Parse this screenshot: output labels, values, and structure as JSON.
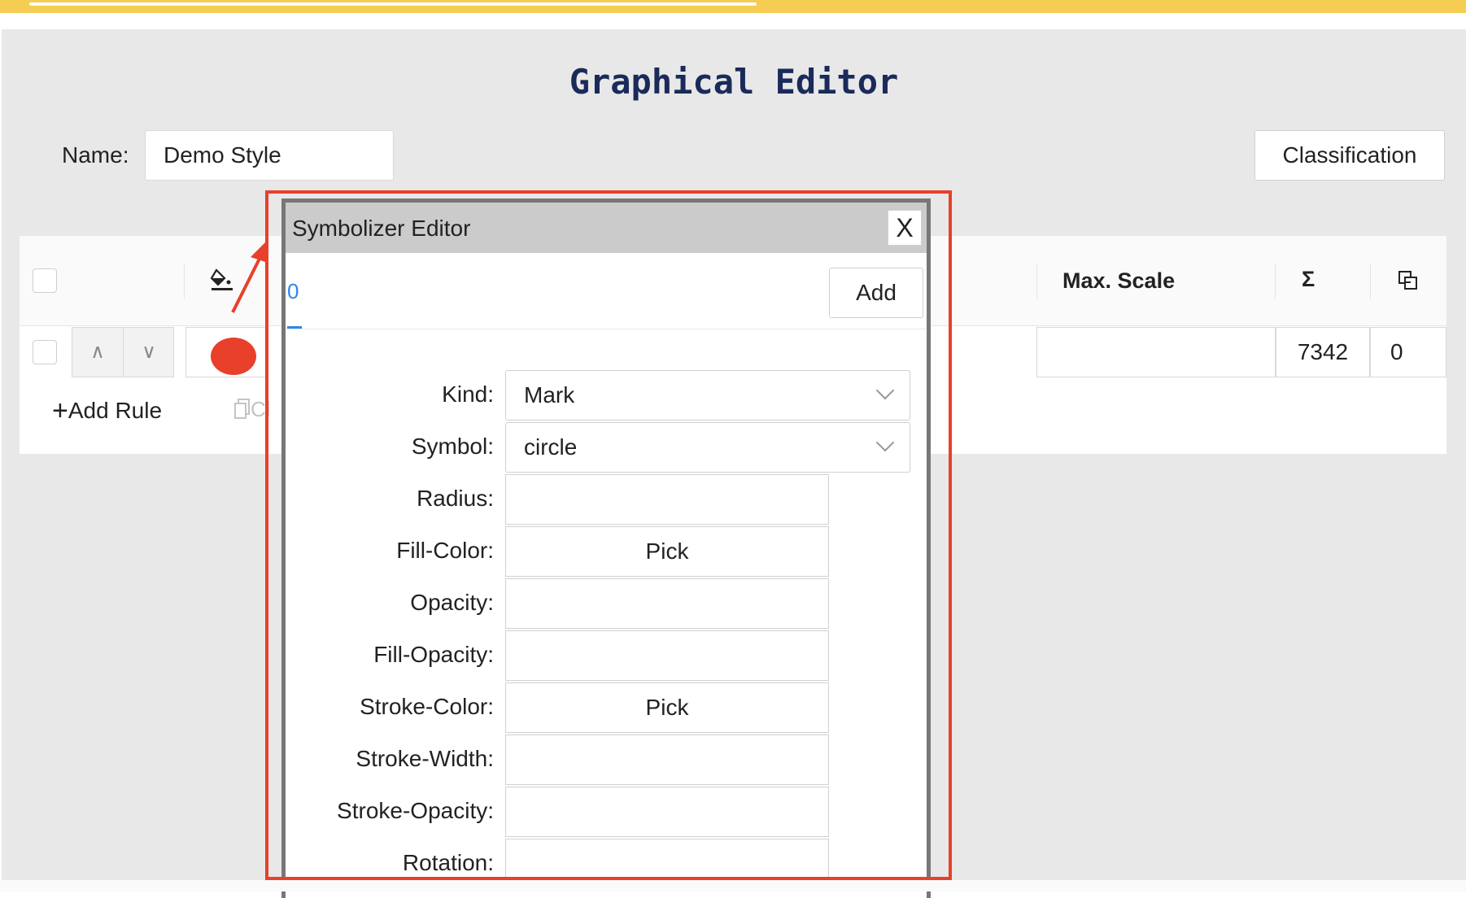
{
  "header": {
    "title": "Graphical Editor"
  },
  "style": {
    "name_label": "Name:",
    "name_value": "Demo Style",
    "classification_label": "Classification"
  },
  "rules_table": {
    "headers": {
      "max_scale": "Max. Scale",
      "sigma": "Σ"
    },
    "header_icons": [
      "paint-bucket-icon",
      "copy-columns-icon"
    ],
    "row": {
      "count": "7342",
      "duplicates": "0",
      "symbol_color": "#e8402b"
    },
    "add_rule_label": "Add Rule",
    "clone_label_partial": "Cl"
  },
  "symbolizer_editor": {
    "title": "Symbolizer Editor",
    "close_glyph": "X",
    "tab_label": "0",
    "add_label": "Add",
    "fields": {
      "kind_label": "Kind:",
      "kind_value": "Mark",
      "symbol_label": "Symbol:",
      "symbol_value": "circle",
      "radius_label": "Radius:",
      "fill_color_label": "Fill-Color:",
      "fill_color_button": "Pick",
      "opacity_label": "Opacity:",
      "fill_opacity_label": "Fill-Opacity:",
      "stroke_color_label": "Stroke-Color:",
      "stroke_color_button": "Pick",
      "stroke_width_label": "Stroke-Width:",
      "stroke_opacity_label": "Stroke-Opacity:",
      "rotation_label": "Rotation:"
    }
  },
  "colors": {
    "accent_bar": "#f4cd52",
    "highlight": "#e8402b",
    "title": "#1a2a5a",
    "tab_active": "#2f86e8"
  }
}
